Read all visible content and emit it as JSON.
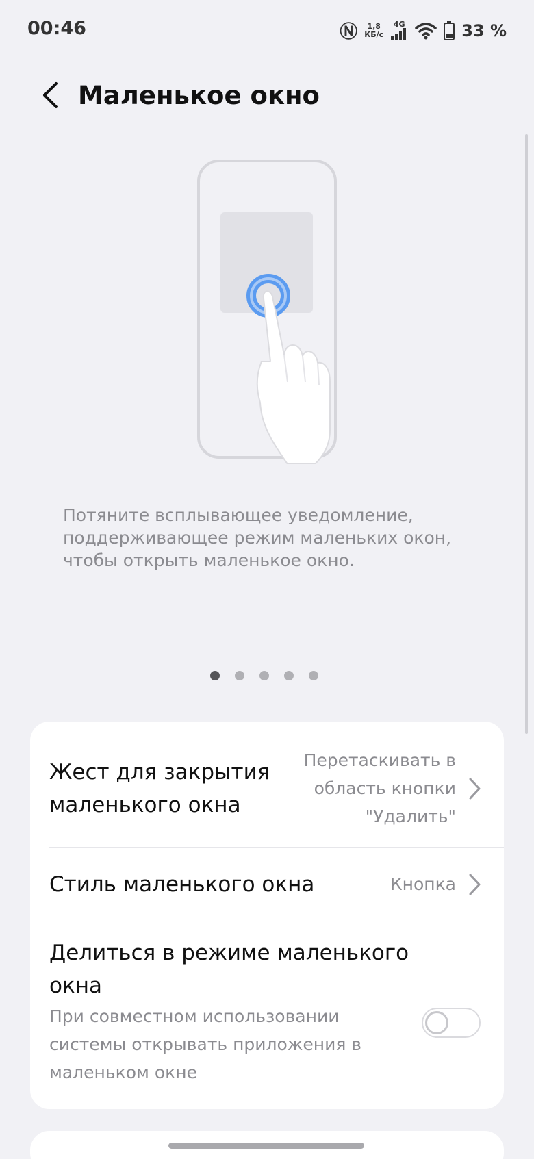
{
  "status_bar": {
    "time": "00:46",
    "speed_value": "1,8",
    "speed_unit": "КБ/с",
    "network": "4G",
    "battery": "33 %"
  },
  "header": {
    "title": "Маленькое окно"
  },
  "tutorial": {
    "description": "Потяните всплывающее уведомление, поддерживающее режим маленьких окон, чтобы открыть маленькое окно.",
    "page_index": 1,
    "page_count": 5
  },
  "settings": {
    "close_gesture": {
      "title_line1": "Жест для закрытия",
      "title_line2": "маленького окна",
      "value_line1": "Перетаскивать в",
      "value_line2": "область кнопки",
      "value_line3": "\"Удалить\""
    },
    "window_style": {
      "title": "Стиль маленького окна",
      "value": "Кнопка"
    },
    "share_mode": {
      "title_line1": "Делиться в режиме маленького",
      "title_line2": "окна",
      "subtitle_line1": "При совместном использовании",
      "subtitle_line2": "системы открывать приложения в",
      "subtitle_line3": "маленьком окне",
      "enabled": false
    }
  },
  "colors": {
    "background": "#f1f1f5",
    "card": "#ffffff",
    "accent": "#5b9bf0",
    "secondary_text": "#8b8b90"
  }
}
